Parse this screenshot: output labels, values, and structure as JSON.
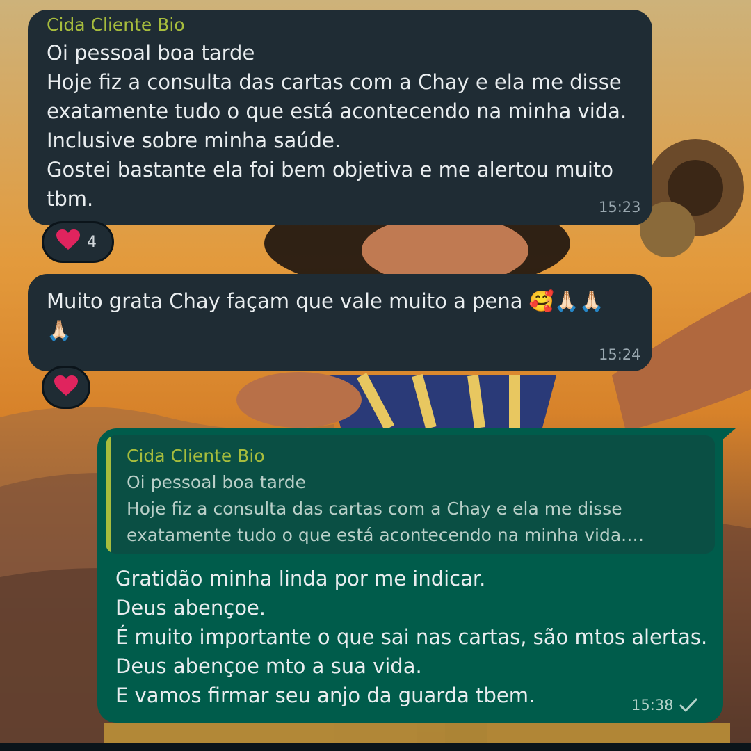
{
  "messages": [
    {
      "sender": "Cida Cliente Bio",
      "lines": [
        "Oi pessoal boa tarde",
        "Hoje fiz a consulta das cartas com a Chay e ela me disse",
        "exatamente tudo o que está acontecendo na minha vida.",
        "Inclusive sobre minha saúde.",
        "Gostei bastante ela foi bem objetiva e me alertou muito",
        "tbm."
      ],
      "time": "15:23",
      "reaction": {
        "emoji": "❤️",
        "count": "4"
      }
    },
    {
      "lines": [
        "Muito grata Chay façam que vale muito a pena 🥰🙏🏻🙏🏻",
        "🙏🏻"
      ],
      "time": "15:24",
      "reaction": {
        "emoji": "❤️"
      }
    },
    {
      "quote": {
        "sender": "Cida Cliente Bio",
        "lines": [
          "Oi pessoal boa tarde",
          "Hoje fiz a consulta das cartas com a Chay e ela me disse",
          "exatamente tudo o que está acontecendo na minha vida.…"
        ]
      },
      "lines": [
        "Gratidão minha linda por me indicar.",
        "Deus abençoe.",
        "É muito importante o que sai nas cartas, são mtos alertas.",
        "Deus abençoe mto a sua vida.",
        "E vamos firmar seu anjo da guarda tbem."
      ],
      "time": "15:38",
      "status_icon": "single-check-icon"
    }
  ],
  "colors": {
    "incoming_bubble": "#1f2c34",
    "outgoing_bubble": "#005c4b",
    "sender_name": "#a7bd3d",
    "reaction_heart": "#e0245e"
  }
}
